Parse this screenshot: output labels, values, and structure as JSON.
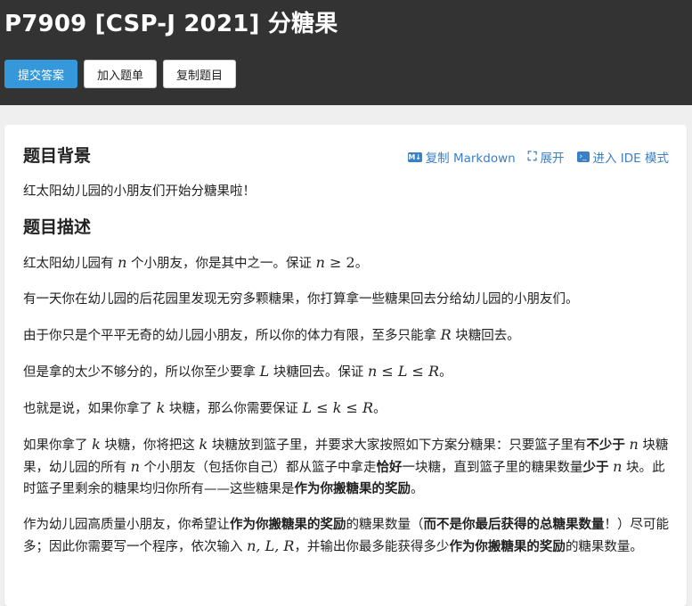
{
  "problem": {
    "title": "P7909 [CSP-J 2021] 分糖果"
  },
  "toolbar": {
    "submit_label": "提交答案",
    "add_to_list_label": "加入题单",
    "copy_problem_label": "复制题目"
  },
  "actions": {
    "copy_markdown_label": "复制 Markdown",
    "expand_label": "展开",
    "ide_mode_label": "进入 IDE 模式"
  },
  "background": {
    "heading": "题目背景",
    "text": "红太阳幼儿园的小朋友们开始分糖果啦！"
  },
  "description": {
    "heading": "题目描述",
    "p1": {
      "a": "红太阳幼儿园有 ",
      "n": "n",
      "b": " 个小朋友，你是其中之一。保证 ",
      "f1": "n",
      "f2": " ≥ 2",
      "c": "。"
    },
    "p2": "有一天你在幼儿园的后花园里发现无穷多颗糖果，你打算拿一些糖果回去分给幼儿园的小朋友们。",
    "p3": {
      "a": "由于你只是个平平无奇的幼儿园小朋友，所以你的体力有限，至多只能拿 ",
      "R": "R",
      "b": " 块糖回去。"
    },
    "p4": {
      "a": "但是拿的太少不够分的，所以你至少要拿 ",
      "L": "L",
      "b": " 块糖回去。保证 ",
      "f": "n ≤ L ≤ R",
      "c": "。"
    },
    "p5": {
      "a": "也就是说，如果你拿了 ",
      "k": "k",
      "b": " 块糖，那么你需要保证 ",
      "f": "L ≤ k ≤ R",
      "c": "。"
    },
    "p6": {
      "a": "如果你拿了 ",
      "k1": "k",
      "b": " 块糖，你将把这 ",
      "k2": "k",
      "c": " 块糖放到篮子里，并要求大家按照如下方案分糖果：只要篮子里有",
      "b1": "不少于",
      "n1": "n",
      "d": " 块糖果，幼儿园的所有 ",
      "n2": "n",
      "e": " 个小朋友（包括你自己）都从篮子中拿走",
      "b2": "恰好",
      "f": "一块糖，直到篮子里的糖果数量",
      "b3": "少于",
      "n3": "n",
      "g": " 块。此时篮子里剩余的糖果均归你所有——这些糖果是",
      "b4": "作为你搬糖果的奖励",
      "h": "。"
    },
    "p7": {
      "a": "作为幼儿园高质量小朋友，你希望让",
      "b1": "作为你搬糖果的奖励",
      "b": "的糖果数量（",
      "b2": "而不是你最后获得的总糖果数量",
      "c": "！）尽可能多；因此你需要写一个程序，依次输入 ",
      "f": "n, L, R",
      "d": "，并输出你最多能获得多少",
      "b3": "作为你搬糖果的奖励",
      "e": "的糖果数量。"
    }
  }
}
